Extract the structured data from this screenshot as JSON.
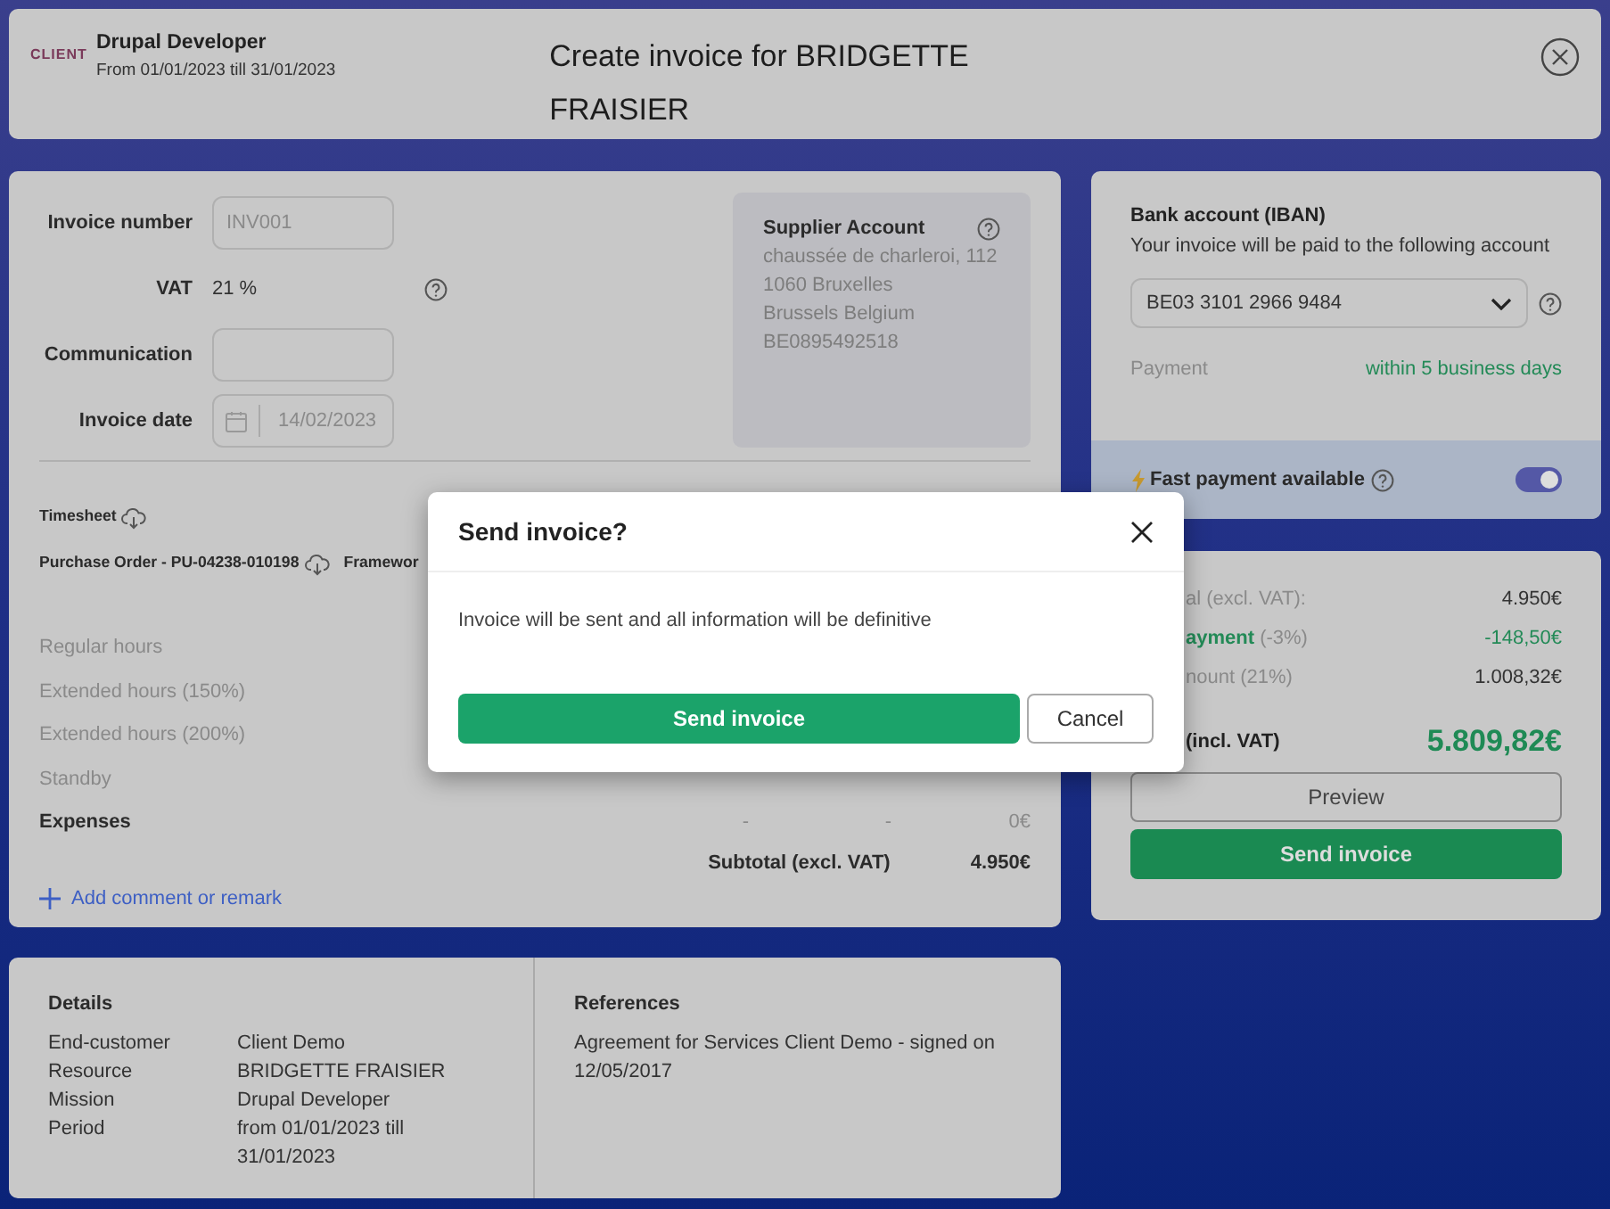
{
  "header": {
    "logo": "CLIENT",
    "mission": "Drupal Developer",
    "period": "From 01/01/2023 till 31/01/2023",
    "title": "Create invoice for BRIDGETTE FRAISIER"
  },
  "form": {
    "fields": [
      {
        "kind": "input",
        "label": "Invoice number",
        "placeholder": "INV001"
      },
      {
        "kind": "text",
        "label": "VAT",
        "value": "21 %",
        "help": true
      },
      {
        "kind": "input",
        "label": "Communication"
      },
      {
        "kind": "date",
        "label": "Invoice date",
        "value": "14/02/2023"
      }
    ]
  },
  "supplier": {
    "title": "Supplier Account",
    "lines": [
      "chaussée de charleroi, 112",
      "1060 Bruxelles",
      "Brussels Belgium",
      "BE0895492518"
    ]
  },
  "document_rows": [
    [
      {
        "label": "Timesheet",
        "download": true
      }
    ],
    [
      {
        "label": "Purchase Order - PU-04238-010198",
        "download": true
      },
      {
        "label": "Framewor",
        "download": false
      }
    ]
  ],
  "hours": [
    {
      "label": "Regular hours",
      "bold": false
    },
    {
      "label": "Extended hours (150%)",
      "bold": false
    },
    {
      "label": "Extended hours (200%)",
      "bold": false
    },
    {
      "label": "Standby",
      "bold": false
    },
    {
      "label": "Expenses",
      "bold": true,
      "values": [
        "-",
        "-",
        "0€"
      ]
    }
  ],
  "subtotal": {
    "label": "Subtotal (excl. VAT)",
    "value": "4.950€"
  },
  "add_comment": "Add comment or remark",
  "bank": {
    "title": "Bank account (IBAN)",
    "subtitle": "Your invoice will be paid to the following account",
    "iban": "BE03 3101 2966 9484",
    "payment_label": "Payment",
    "payment_value": "within 5 business days"
  },
  "fast_payment": {
    "label": "Fast payment available",
    "on": true
  },
  "summary": {
    "rows": [
      {
        "kind": "plain",
        "label": "al (excl. VAT):",
        "value": "4.950€"
      },
      {
        "kind": "discount",
        "label": "**ayment** (-3%)",
        "value": "-148,50€"
      },
      {
        "kind": "plain",
        "label": "nount (21%)",
        "value": "1.008,32€"
      }
    ],
    "total": {
      "label": "(incl. VAT)",
      "value": "5.809,82€"
    },
    "buttons": [
      {
        "kind": "outline",
        "label": "Preview"
      },
      {
        "kind": "primary",
        "label": "Send invoice"
      }
    ]
  },
  "details": {
    "title": "Details",
    "rows": [
      {
        "label": "End-customer",
        "value": "Client Demo"
      },
      {
        "label": "Resource",
        "value": "BRIDGETTE FRAISIER"
      },
      {
        "label": "Mission",
        "value": "Drupal Developer"
      },
      {
        "label": "Period",
        "value": "from 01/01/2023 till 31/01/2023"
      }
    ]
  },
  "references": {
    "title": "References",
    "text": "Agreement for Services Client Demo - signed on 12/05/2017"
  },
  "modal": {
    "title": "Send invoice?",
    "body": "Invoice will be sent and all information will be definitive",
    "buttons": [
      {
        "kind": "primary",
        "label": "Send invoice"
      },
      {
        "kind": "outline",
        "label": "Cancel"
      }
    ]
  }
}
